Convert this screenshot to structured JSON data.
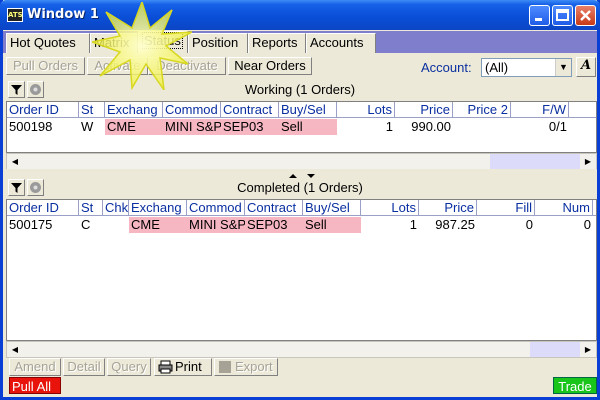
{
  "window": {
    "title": "Window 1",
    "icon_text": "ATS"
  },
  "tabs": [
    "Hot Quotes",
    "Matrix",
    "Status",
    "Position",
    "Reports",
    "Accounts"
  ],
  "active_tab": "Status",
  "toolbar": {
    "pull_orders": "Pull Orders",
    "activate": "Activate",
    "deactivate": "Deactivate",
    "near_orders": "Near Orders",
    "account_label": "Account:",
    "account_value": "(All)",
    "font_button": "A"
  },
  "working": {
    "title": "Working (1 Orders)",
    "columns": [
      "Order ID",
      "St",
      "Exchang",
      "Commod",
      "Contract",
      "Buy/Sel",
      "Lots",
      "Price",
      "Price 2",
      "F/W"
    ],
    "rows": [
      [
        "500198",
        "W",
        "CME",
        "MINI S&P",
        "SEP03",
        "Sell",
        "1",
        "990.00",
        "",
        "0/1"
      ]
    ]
  },
  "completed": {
    "title": "Completed (1 Orders)",
    "columns": [
      "Order ID",
      "St",
      "Chk",
      "Exchang",
      "Commod",
      "Contract",
      "Buy/Sel",
      "Lots",
      "Price",
      "Fill",
      "Num"
    ],
    "rows": [
      [
        "500175",
        "C",
        "",
        "CME",
        "MINI S&P",
        "SEP03",
        "Sell",
        "1",
        "987.25",
        "0",
        "0"
      ]
    ]
  },
  "bottom": {
    "amend": "Amend",
    "detail": "Detail",
    "query": "Query",
    "print": "Print",
    "export": "Export",
    "pull_all": "Pull All",
    "trade": "Trade"
  },
  "colors": {
    "title_blue": "#0a4fd8",
    "tab_bar": "#7e7ecd",
    "pink_cell": "#f6b6c2",
    "pull_all": "#e8130a",
    "trade": "#19c51b",
    "header_text": "#0a2fa0"
  }
}
